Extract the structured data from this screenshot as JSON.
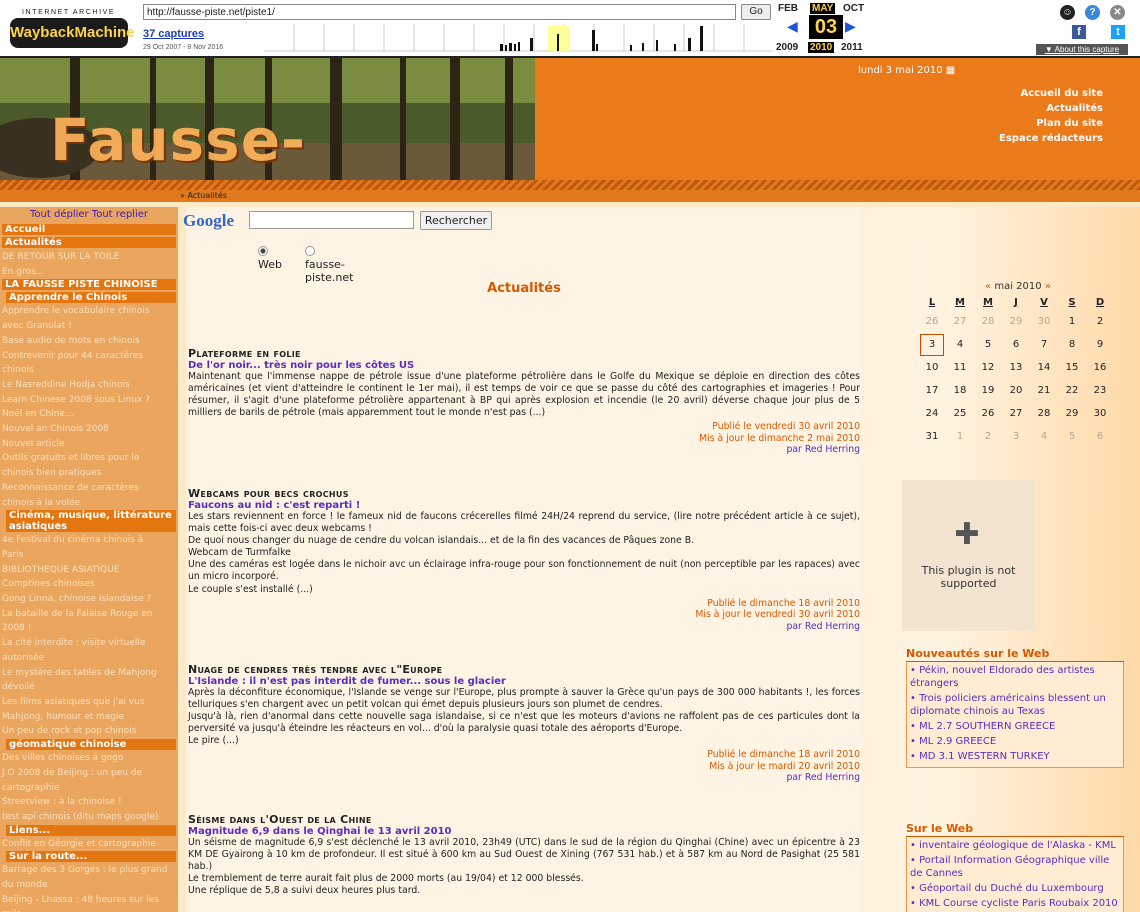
{
  "wayback": {
    "ia_label": "INTERNET ARCHIVE",
    "logo": "WaybackMachine",
    "url": "http://fausse-piste.net/piste1/",
    "go": "Go",
    "captures": "37 captures",
    "range": "29 Oct 2007 - 8 Nov 2016",
    "months": [
      "FEB",
      "MAY",
      "OCT"
    ],
    "day": "03",
    "years": [
      "2009",
      "2010",
      "2011"
    ],
    "about": "▼ About this capture"
  },
  "banner": {
    "title": "Fausse-Piste.net",
    "date": "lundi 3 mai 2010",
    "nav": [
      "Accueil du site",
      "Actualités",
      "Plan du site",
      "Espace rédacteurs"
    ]
  },
  "breadcrumb": "» Actualités",
  "sidebar": {
    "toggle": "Tout déplier Tout replier",
    "sections": [
      {
        "h": "Accueil",
        "items": []
      },
      {
        "h": "Actualités",
        "items": [
          "DE RETOUR SUR LA TOILE",
          "En gros..."
        ]
      },
      {
        "h": "LA FAUSSE PISTE CHINOISE",
        "sub": "Apprendre le Chinois",
        "items": [
          "Apprendre le vocabulaire chinois",
          "avec Granulat !",
          "Base audio de mots en chinois",
          "Contrevenir pour 44 caractères",
          "chinois",
          "Le Nasreddine Hodja chinois",
          "Learn Chinese 2008 sous Linux ?",
          "Noël en Chine...",
          "Nouvel an Chinois 2008",
          "Nouvel article",
          "Outils gratuits et libres pour le",
          "chinois bien pratiques",
          "Reconnaissance de caractères",
          "chinois à la volée"
        ]
      },
      {
        "sub": "Cinéma, musique, littérature asiatiques",
        "items": [
          "4e Festival du cinéma chinois à",
          "Paris",
          "BIBLIOTHEQUE ASIATIQUE",
          "Comptines chinoises",
          "Gong Linna, chinoise islandaise ?",
          "La bataille de la Falaise Rouge en",
          "2008 !",
          "La cité interdite : visite virtuelle",
          "autorisée",
          "Le mystère des tables de Mahjong",
          "dévoilé",
          "Les films asiatiques que j'ai vus",
          "Mahjong, humour et magie",
          "Un peu de rock et pop chinois"
        ]
      },
      {
        "sub": "géomatique chinoise",
        "items": [
          "Des villes chinoises à gogo",
          "J.O 2008 de Beijing : un peu de",
          "cartographie",
          "Streetview : à la chinoise !",
          "test api chinois (ditu maps google)"
        ]
      },
      {
        "sub": "Liens...",
        "items": [
          "Conflit en Géorgie et cartographie"
        ]
      },
      {
        "sub": "Sur la route...",
        "items": [
          "Barrage des 3 Gorges : le plus grand",
          "du monde",
          "Beijing - Lhassa : 48 heures sur les",
          "rails"
        ]
      }
    ]
  },
  "search": {
    "logo": "Google",
    "button": "Rechercher",
    "opt1": "Web",
    "opt2": "fausse-piste.net"
  },
  "page_title": "Actualités",
  "articles": [
    {
      "title": "Plateforme en folie",
      "subtitle": "De l'or noir... très noir pour les côtes US",
      "body": "Maintenant que l'immense nappe de pétrole issue d'une plateforme pétrolière dans le Golfe du Mexique se déploie en direction des côtes américaines (et vient d'atteindre le continent le 1er mai), il est temps de voir ce que se passe du côté des cartographies et imageries ! Pour résumer, il s'agit d'une plateforme pétrolière appartenant à BP qui après explosion et incendie (le 20 avril) déverse chaque jour plus de 5 milliers de barils de pétrole (mais apparemment tout le monde n'est pas (...)",
      "pub": "Publié le vendredi 30 avril 2010",
      "upd": "Mis à jour le dimanche 2 mai 2010",
      "by": "par Red Herring"
    },
    {
      "title": "Webcams pour becs crochus",
      "subtitle": "Faucons au nid : c'est reparti !",
      "body": "Les stars reviennent en force ! le fameux nid de faucons crécerelles filmé 24H/24 reprend du service, (lire notre précédent article à ce sujet), mais cette fois-ci avec deux webcams !|De quoi nous changer du nuage de cendre du volcan islandais... et de la fin des vacances de Pâques zone B.|Webcam de Turmfalke|Une des caméras est logée dans le nichoir avc un éclairage infra-rouge pour son fonctionnement de nuit (non perceptible par les rapaces) avec un micro incorporé.|Le couple s'est installé (...)",
      "pub": "Publié le dimanche 18 avril 2010",
      "upd": "Mis à jour le vendredi 30 avril 2010",
      "by": "par Red Herring"
    },
    {
      "title": "Nuage de cendres très tendre avec l\"Europe",
      "subtitle": "L'Islande : il n'est pas interdit de fumer... sous le glacier",
      "body": "Après la déconfiture économique, l'Islande se venge sur l'Europe, plus prompte à sauver la Grèce qu'un pays de 300 000 habitants !, les forces telluriques s'en chargent avec un petit volcan qui émet depuis plusieurs jours son plumet de cendres.|Jusqu'à là, rien d'anormal dans cette nouvelle saga islandaise, si ce n'est que les moteurs d'avions ne raffolent pas de ces particules dont la perversité va jusqu'à éteindre les réacteurs en vol... d'où la paralysie quasi totale des aéroports d'Europe.|Le pire (...)",
      "pub": "Publié le dimanche 18 avril 2010",
      "upd": "Mis à jour le mardi 20 avril 2010",
      "by": "par Red Herring"
    },
    {
      "title": "Séisme dans l'Ouest de la Chine",
      "subtitle": "Magnitude 6,9 dans le Qinghai le 13 avril 2010",
      "body": "Un séisme de magnitude 6,9 s'est déclenché le 13 avril 2010, 23h49 (UTC) dans le sud de la région du Qinghai (Chine) avec un épicentre à 23 KM DE Gyairong à 10 km de profondeur. Il est situé à 600 km au Sud Ouest de Xining (767 531 hab.) et à 587 km au Nord de Pasighat (25 581 hab.)|Le tremblement de terre aurait fait plus de 2000 morts (au 19/04) et 12 000 blessés.|Une réplique de 5,8 a suivi deux heures plus tard.",
      "pub": "",
      "upd": "",
      "by": ""
    }
  ],
  "calendar": {
    "prev": "«",
    "month": "mai 2010",
    "next": "»",
    "days": [
      "L",
      "M",
      "M",
      "J",
      "V",
      "S",
      "D"
    ],
    "weeks": [
      [
        "26",
        "27",
        "28",
        "29",
        "30",
        "1",
        "2"
      ],
      [
        "3",
        "4",
        "5",
        "6",
        "7",
        "8",
        "9"
      ],
      [
        "10",
        "11",
        "12",
        "13",
        "14",
        "15",
        "16"
      ],
      [
        "17",
        "18",
        "19",
        "20",
        "21",
        "22",
        "23"
      ],
      [
        "24",
        "25",
        "26",
        "27",
        "28",
        "29",
        "30"
      ],
      [
        "31",
        "1",
        "2",
        "3",
        "4",
        "5",
        "6"
      ]
    ]
  },
  "plugin_msg": "This plugin is not supported",
  "nouveautes": {
    "title": "Nouveautés sur le Web",
    "items": [
      "Pékin, nouvel Eldorado des artistes étrangers",
      "Trois policiers américains blessent un diplomate chinois au Texas",
      "ML 2.7 SOUTHERN GREECE",
      "ML 2.9 GREECE",
      "MD 3.1 WESTERN TURKEY"
    ]
  },
  "surleweb": {
    "title": "Sur le Web",
    "items": [
      "inventaire géologique de l'Alaska - KML",
      "Portail Information Géographique ville de Cannes",
      "Géoportail du Duché du Luxembourg",
      "KML Course cycliste Paris Roubaix 2010"
    ]
  }
}
